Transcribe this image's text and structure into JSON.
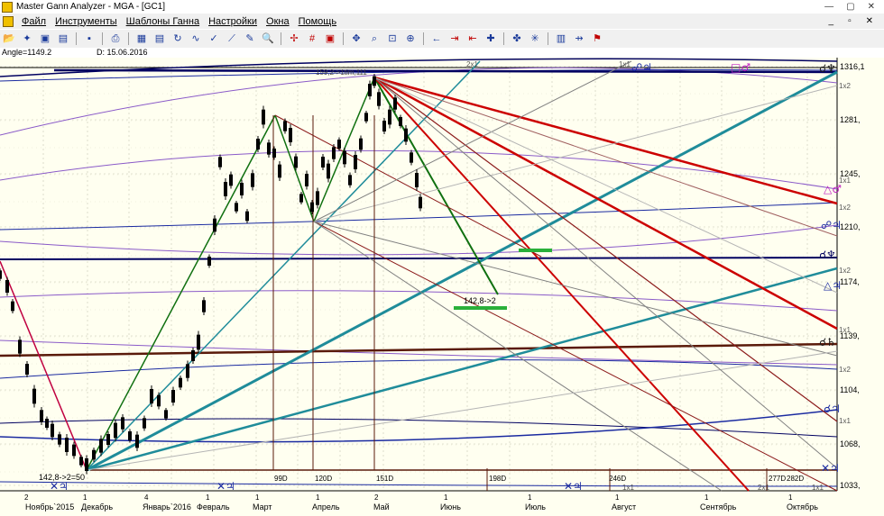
{
  "window": {
    "title": "Master Gann Analyzer - MGA - [GC1]",
    "controls": [
      "—",
      "▢",
      "✕"
    ]
  },
  "menu": {
    "items": [
      "Файл",
      "Инструменты",
      "Шаблоны Ганна",
      "Настройки",
      "Окна",
      "Помощь"
    ],
    "controls": [
      "_",
      "▫",
      "✕"
    ]
  },
  "toolbar": {
    "groups": [
      [
        {
          "name": "open-icon",
          "glyph": "📂"
        },
        {
          "name": "wand-icon",
          "glyph": "✦"
        },
        {
          "name": "chart-open-icon",
          "glyph": "▣"
        },
        {
          "name": "folder-icon",
          "glyph": "▤"
        }
      ],
      [
        {
          "name": "save-icon",
          "glyph": "▪"
        }
      ],
      [
        {
          "name": "print-icon",
          "glyph": "⎙"
        }
      ],
      [
        {
          "name": "grid-icon",
          "glyph": "▦"
        },
        {
          "name": "table-icon",
          "glyph": "▤"
        },
        {
          "name": "cycle-icon",
          "glyph": "↻"
        },
        {
          "name": "wave-icon",
          "glyph": "∿"
        },
        {
          "name": "check-icon",
          "glyph": "✓"
        },
        {
          "name": "fan-icon",
          "glyph": "⟋"
        },
        {
          "name": "pencil-icon",
          "glyph": "✎"
        },
        {
          "name": "zoom-icon",
          "glyph": "🔍"
        }
      ],
      [
        {
          "name": "cross-red-icon",
          "glyph": "✢"
        },
        {
          "name": "grid-red-icon",
          "glyph": "#"
        },
        {
          "name": "box-red-icon",
          "glyph": "▣"
        }
      ],
      [
        {
          "name": "move-icon",
          "glyph": "✥"
        },
        {
          "name": "zoom-box-icon",
          "glyph": "⌕"
        },
        {
          "name": "fit-icon",
          "glyph": "⊡"
        },
        {
          "name": "zoom-in-icon",
          "glyph": "⊕"
        }
      ],
      [
        {
          "name": "arrow-left-icon",
          "glyph": "←"
        },
        {
          "name": "bar-right-icon",
          "glyph": "⇥"
        },
        {
          "name": "bar-left-icon",
          "glyph": "⇤"
        },
        {
          "name": "crosshair-icon",
          "glyph": "✚"
        }
      ],
      [
        {
          "name": "cursor-icon",
          "glyph": "✤"
        },
        {
          "name": "star-icon",
          "glyph": "✳"
        }
      ],
      [
        {
          "name": "grid-gray-icon",
          "glyph": "▥"
        },
        {
          "name": "arrow-gray-icon",
          "glyph": "⇸"
        },
        {
          "name": "flag-icon",
          "glyph": "⚑"
        }
      ]
    ]
  },
  "info": {
    "angle": "Angle=1149.2",
    "date": "D: 15.06.2016"
  },
  "colors": {
    "navy": "#000060",
    "blue": "#1a2aa0",
    "teal": "#1f8c9a",
    "red": "#cc0000",
    "dkred": "#8b1a1a",
    "brown": "#5a1a0a",
    "green": "#107010",
    "purple": "#8a5ac8",
    "gray": "#808080",
    "ltgray": "#b4b4b4",
    "bright_green": "#2ab03a",
    "magenta": "#c020c0"
  },
  "chart_data": {
    "type": "candlestick",
    "y_ticks": [
      "1316,1",
      "1281,",
      "1245,",
      "1210,",
      "1174,",
      "1139,",
      "1104,",
      "1068,",
      "1033,"
    ],
    "y_range": [
      1033,
      1316.1
    ],
    "x_months": [
      "Ноябрь`2015",
      "Декабрь",
      "Январь`2016",
      "Февраль",
      "Март",
      "Апрель",
      "Май",
      "Июнь",
      "Июль",
      "Август",
      "Сентябрь",
      "Октябрь"
    ],
    "x_day_marks": [
      "2",
      "1",
      "4",
      "1",
      "1",
      "1",
      "2",
      "1",
      "1",
      "1",
      "1",
      "1"
    ],
    "day_count_labels": [
      "99D",
      "120D",
      "151D",
      "198D",
      "246D",
      "277D",
      "282D"
    ],
    "annotations": {
      "top_label": "159,2->1tim,111",
      "target_label": "142,8->2",
      "bottom_left_label": "142,8->2=50",
      "fan_labels": [
        "2x1",
        "1x1",
        "1x2",
        "1x1",
        "1x2",
        "1x2",
        "1x1",
        "1x2",
        "1x1",
        "1x1",
        "2x1",
        "1x1"
      ]
    },
    "planet_labels": [
      {
        "glyph": "☍♃",
        "color": "#1a2aa0"
      },
      {
        "glyph": "□♂",
        "color": "#c020c0"
      },
      {
        "glyph": "☌♆",
        "color": "#1a1a1a"
      },
      {
        "glyph": "△♂",
        "color": "#c020c0"
      },
      {
        "glyph": "☍♃",
        "color": "#1a2aa0"
      },
      {
        "glyph": "☌♆",
        "color": "#000060"
      },
      {
        "glyph": "△♃",
        "color": "#1a2aa0"
      },
      {
        "glyph": "☌♄",
        "color": "#1a1a1a"
      },
      {
        "glyph": "☌♃",
        "color": "#1a2aa0"
      },
      {
        "glyph": "✕♃",
        "color": "#1a2aa0"
      },
      {
        "glyph": "✕♃",
        "color": "#1a2aa0"
      },
      {
        "glyph": "✕♃",
        "color": "#1a2aa0"
      },
      {
        "glyph": "✕♃",
        "color": "#1a2aa0"
      }
    ]
  }
}
